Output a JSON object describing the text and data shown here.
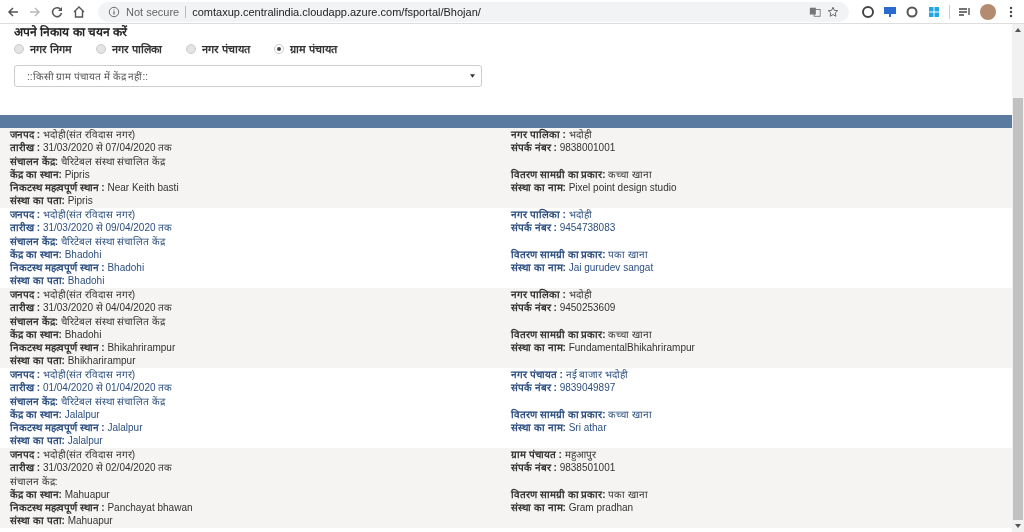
{
  "browser": {
    "security": "Not secure",
    "url": "comtaxup.centralindia.cloudapp.azure.com/fsportal/Bhojan/"
  },
  "selector": {
    "title": "अपने निकाय का चयन करें",
    "options": [
      {
        "label": "नगर निगम",
        "selected": false
      },
      {
        "label": "नगर पालिका",
        "selected": false
      },
      {
        "label": "नगर पंचायत",
        "selected": false
      },
      {
        "label": "ग्राम पंचायत",
        "selected": true
      }
    ],
    "dropdown": {
      "value": "::किसी ग्राम पंचायत में केंद्र नहीं::"
    }
  },
  "records": [
    {
      "shaded": true,
      "left": [
        "**जनपद :** भदोही(संत रविदास नगर)",
        "**तारीख :** 31/03/2020 से 07/04/2020 तक",
        "**संचालन केंद्र:** चैरिटेबल संस्था संचालित केंद्र",
        "**केंद्र का स्थान:** Pipris",
        "**निकटस्थ महत्वपूर्ण स्थान :** Near Keith basti",
        "**संस्था का पता:** Pipris"
      ],
      "right_top": [
        "**नगर पालिका :** भदोही",
        "**संपर्क नंबर :** 9838001001"
      ],
      "right_bottom": [
        "**वितरण सामग्री का प्रकार:** कच्चा खाना",
        "**संस्था का नाम:** Pixel point design studio"
      ]
    },
    {
      "shaded": false,
      "left": [
        "**जनपद :** भदोही(संत रविदास नगर)",
        "**तारीख :** 31/03/2020 से 09/04/2020 तक",
        "**संचालन केंद्र:** चैरिटेबल संस्था संचालित केंद्र",
        "**केंद्र का स्थान:** Bhadohi",
        "**निकटस्थ महत्वपूर्ण स्थान :** Bhadohi",
        "**संस्था का पता:** Bhadohi"
      ],
      "right_top": [
        "**नगर पालिका :** भदोही",
        "**संपर्क नंबर :** 9454738083"
      ],
      "right_bottom": [
        "**वितरण सामग्री का प्रकार:** पका खाना",
        "**संस्था का नाम:** Jai gurudev sangat"
      ]
    },
    {
      "shaded": true,
      "left": [
        "**जनपद :** भदोही(संत रविदास नगर)",
        "**तारीख :** 31/03/2020 से 04/04/2020 तक",
        "**संचालन केंद्र:** चैरिटेबल संस्था संचालित केंद्र",
        "**केंद्र का स्थान:** Bhadohi",
        "**निकटस्थ महत्वपूर्ण स्थान :** Bhikahrirampur",
        "**संस्था का पता:** Bhikharirampur"
      ],
      "right_top": [
        "**नगर पालिका :** भदोही",
        "**संपर्क नंबर :** 9450253609"
      ],
      "right_bottom": [
        "**वितरण सामग्री का प्रकार:** कच्चा खाना",
        "**संस्था का नाम:** FundamentalBhikahrirampur"
      ]
    },
    {
      "shaded": false,
      "left": [
        "**जनपद :** भदोही(संत रविदास नगर)",
        "**तारीख :** 01/04/2020 से 01/04/2020 तक",
        "**संचालन केंद्र:** चैरिटेबल संस्था संचालित केंद्र",
        "**केंद्र का स्थान:** Jalalpur",
        "**निकटस्थ महत्वपूर्ण स्थान :** Jalalpur",
        "**संस्था का पता:** Jalalpur"
      ],
      "right_top": [
        "**नगर पंचायत :** नई बाजार भदोही",
        "**संपर्क नंबर :** 9839049897"
      ],
      "right_bottom": [
        "**वितरण सामग्री का प्रकार:** कच्चा खाना",
        "**संस्था का नाम:** Sri athar"
      ]
    },
    {
      "shaded": true,
      "left": [
        "**जनपद :** भदोही(संत रविदास नगर)",
        "**तारीख :** 31/03/2020 से 02/04/2020 तक",
        "संचालन केंद्र:",
        "**केंद्र का स्थान:** Mahuapur",
        "**निकटस्थ महत्वपूर्ण स्थान :** Panchayat bhawan",
        "**संस्था का पता:** Mahuapur"
      ],
      "right_top": [
        "**ग्राम पंचायत :** महुआपुर",
        "**संपर्क नंबर :** 9838501001"
      ],
      "right_bottom": [
        "**वितरण सामग्री का प्रकार:** पका खाना",
        "**संस्था का नाम:** Gram pradhan"
      ]
    }
  ]
}
